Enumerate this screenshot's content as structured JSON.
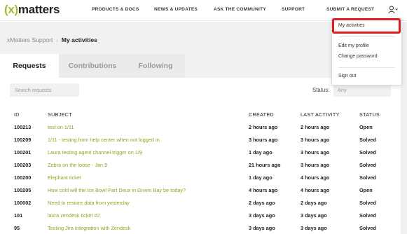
{
  "header": {
    "logo_paren_open": "(x)",
    "logo_text": "matters",
    "nav": [
      "PRODUCTS & DOCS",
      "NEWS & UPDATES",
      "ASK THE COMMUNITY",
      "SUPPORT",
      "SUBMIT A REQUEST"
    ],
    "user_icon": "user-icon"
  },
  "breadcrumb": {
    "root": "xMatters Support",
    "separator": "›",
    "current": "My activities"
  },
  "tabs": [
    "Requests",
    "Contributions",
    "Following"
  ],
  "filters": {
    "search_placeholder": "Search requests",
    "status_label": "Status:",
    "status_value": "Any"
  },
  "table": {
    "columns": [
      "ID",
      "SUBJECT",
      "CREATED",
      "LAST ACTIVITY",
      "STATUS"
    ],
    "rows": [
      [
        "100213",
        "test on 1/11",
        "2 hours ago",
        "2 hours ago",
        "Open"
      ],
      [
        "100209",
        "1/11 - testing from help center when not logged in",
        "3 hours ago",
        "3 hours ago",
        "Solved"
      ],
      [
        "100201",
        "Laura testing agent channel trigger on 1/9",
        "1 day ago",
        "3 hours ago",
        "Solved"
      ],
      [
        "100203",
        "Zebra on the loose - Jan 9",
        "21 hours ago",
        "3 hours ago",
        "Solved"
      ],
      [
        "100200",
        "Elephant ticket",
        "1 day ago",
        "4 hours ago",
        "Solved"
      ],
      [
        "100205",
        "How cold will the Ice Bowl Part Deux in Green Bay be today?",
        "4 hours ago",
        "4 hours ago",
        "Open"
      ],
      [
        "100002",
        "Need to restore data from yesterday",
        "2 days ago",
        "2 days ago",
        "Solved"
      ],
      [
        "101",
        "laura zendesk ticket #2",
        "3 days ago",
        "3 days ago",
        "Solved"
      ],
      [
        "95",
        "Testing Jira Integration with Zendesk",
        "3 days ago",
        "3 days ago",
        "Solved"
      ]
    ]
  },
  "user_menu": {
    "items": [
      "My activities",
      "Edit my profile",
      "Change password",
      "Sign out"
    ],
    "highlight_color": "#e11b22"
  },
  "colors": {
    "accent_green": "#87a922",
    "background_grey": "#f1f1f1"
  }
}
